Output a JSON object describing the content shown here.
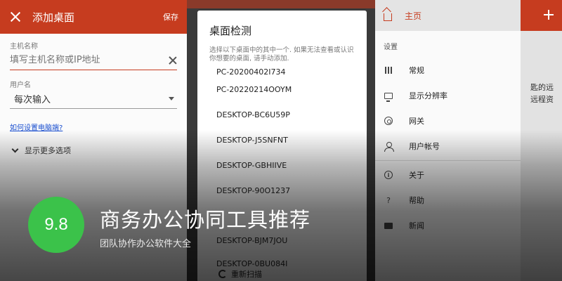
{
  "add_desktop": {
    "title": "添加桌面",
    "save_label": "保存",
    "host_label": "主机名称",
    "host_placeholder": "填写主机名称或IP地址",
    "user_label": "用户名",
    "user_value": "每次输入",
    "help_link": "如何设置电脑端?",
    "more_options": "显示更多选项"
  },
  "detect_dialog": {
    "title": "桌面检测",
    "description": "选择以下桌面中的其中一个. 如果无法查看或认识你想要的桌面, 请手动添加.",
    "desktops": [
      "PC-20200402I734",
      "PC-20220214OOYM",
      "DESKTOP-BC6U59P",
      "DESKTOP-J5SNFNT",
      "DESKTOP-GBHIIVE",
      "DESKTOP-90O1237",
      "DESKTOP-BJM7JOU",
      "DESKTOP-0BU084I"
    ],
    "rescan_label": "重新扫描"
  },
  "drawer": {
    "home_label": "主页",
    "section_settings": "设置",
    "items": [
      {
        "label": "常规",
        "icon": "sliders-icon"
      },
      {
        "label": "显示分辨率",
        "icon": "monitor-icon"
      },
      {
        "label": "网关",
        "icon": "gateway-icon"
      },
      {
        "label": "用户帐号",
        "icon": "user-icon"
      },
      {
        "label": "关于",
        "icon": "info-icon"
      },
      {
        "label": "帮助",
        "icon": "question-icon"
      },
      {
        "label": "新闻",
        "icon": "news-icon"
      }
    ],
    "edge_text_1": "匙的远",
    "edge_text_2": "远程资"
  },
  "promo": {
    "score": "9.8",
    "title": "商务办公协同工具推荐",
    "subtitle": "团队协作办公软件大全"
  },
  "colors": {
    "brand_red": "#c63c1f",
    "score_green": "#3bc24a",
    "link_blue": "#1a4fcf"
  }
}
